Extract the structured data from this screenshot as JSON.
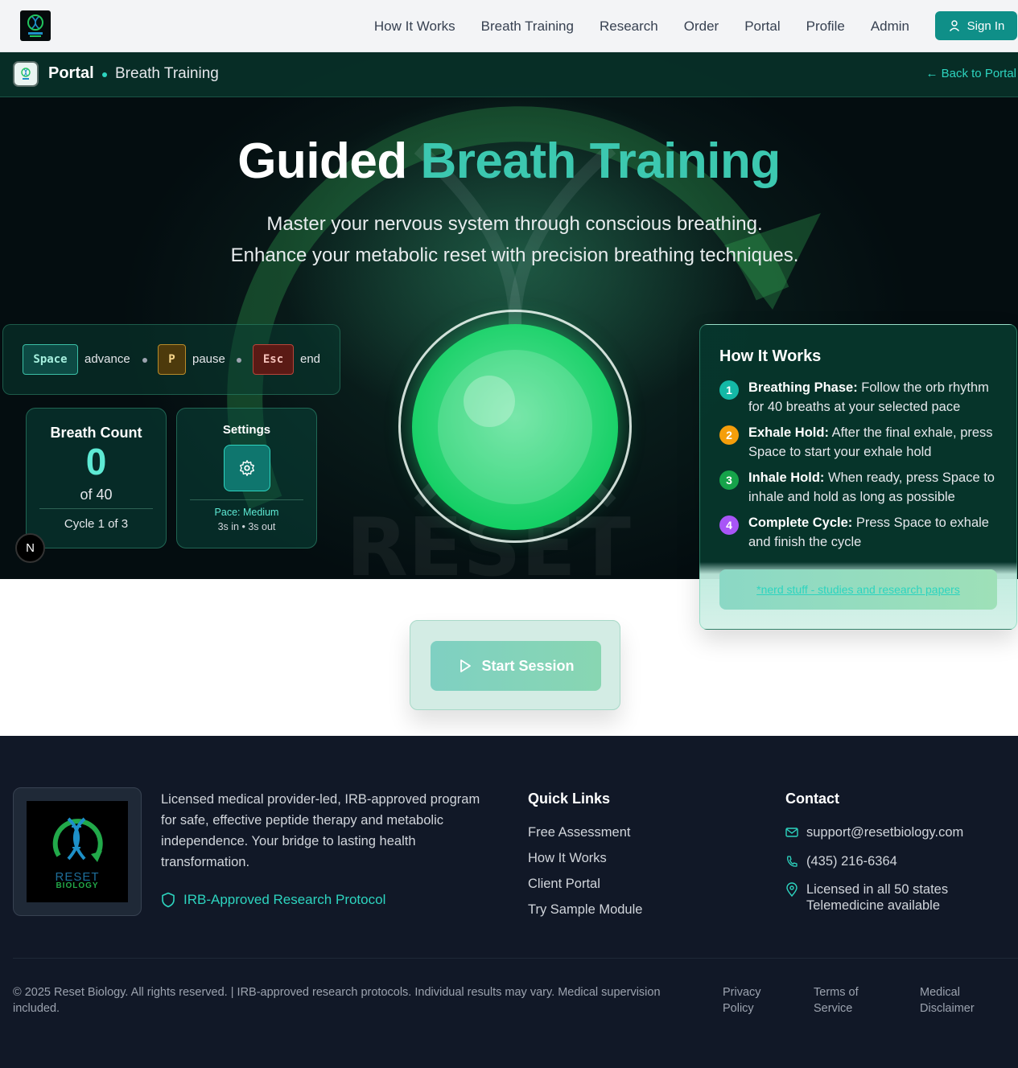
{
  "nav": {
    "logo": {
      "text_top": "RESET",
      "text_bottom": "BIOLOGY"
    },
    "links": [
      "How It Works",
      "Breath Training",
      "Research",
      "Order",
      "Portal",
      "Profile",
      "Admin"
    ],
    "signin": "Sign In"
  },
  "portal_bar": {
    "title": "Portal",
    "subtitle": "Breath Training",
    "back": "← Back to Portal"
  },
  "hero": {
    "title_a": "Guided",
    "title_b": "Breath Training",
    "line1": "Master your nervous system through conscious breathing.",
    "line2": "Enhance your metabolic reset with precision breathing techniques."
  },
  "keys": {
    "space_key": "Space",
    "space_label": "advance",
    "p_key": "P",
    "p_label": "pause",
    "esc_key": "Esc",
    "esc_label": "end"
  },
  "breath_count": {
    "title": "Breath Count",
    "value": "0",
    "of": "of 40",
    "cycle": "Cycle 1 of 3"
  },
  "settings": {
    "title": "Settings",
    "pace": "Pace: Medium",
    "timing": "3s in • 3s out"
  },
  "floating_button": {
    "label": "N"
  },
  "how_it_works": {
    "title": "How It Works",
    "steps": [
      {
        "n": "1",
        "bold": "Breathing Phase:",
        "text": " Follow the orb rhythm for 40 breaths at your selected pace",
        "color": "#14b8a6"
      },
      {
        "n": "2",
        "bold": "Exhale Hold:",
        "text": " After the final exhale, press Space to start your exhale hold",
        "color": "#f59e0b"
      },
      {
        "n": "3",
        "bold": "Inhale Hold:",
        "text": " When ready, press Space to inhale and hold as long as possible",
        "color": "#16a34a"
      },
      {
        "n": "4",
        "bold": "Complete Cycle:",
        "text": " Press Space to exhale and finish the cycle",
        "color": "#a855f7"
      }
    ],
    "nerd_link": "*nerd stuff - studies and research papers"
  },
  "start": {
    "label": "Start Session"
  },
  "footer": {
    "logo": {
      "text_top": "RESET",
      "text_bottom": "BIOLOGY"
    },
    "description": "Licensed medical provider-led, IRB-approved program for safe, effective peptide therapy and metabolic independence. Your bridge to lasting health transformation.",
    "irb": "IRB-Approved Research Protocol",
    "quick_links_title": "Quick Links",
    "quick_links": [
      "Free Assessment",
      "How It Works",
      "Client Portal",
      "Try Sample Module"
    ],
    "contact_title": "Contact",
    "email": "support@resetbiology.com",
    "phone": "(435) 216-6364",
    "location_1": "Licensed in all 50 states",
    "location_2": "Telemedicine available",
    "copyright": "© 2025 Reset Biology. All rights reserved. | IRB-approved research protocols. Individual results may vary. Medical supervision included.",
    "legal": [
      "Privacy Policy",
      "Terms of Service",
      "Medical Disclaimer"
    ]
  },
  "colors": {
    "brand_teal": "#0f8f88",
    "accent_teal": "#2dd4bf",
    "orb_green": "#12cf63",
    "footer_bg": "#111827"
  }
}
